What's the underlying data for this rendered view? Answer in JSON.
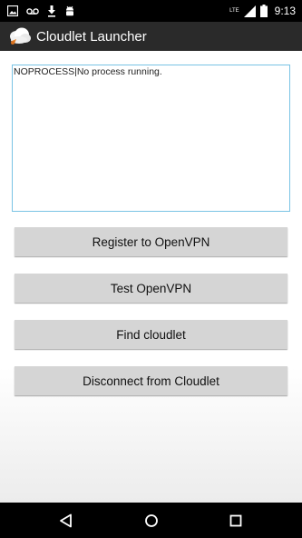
{
  "status_bar": {
    "icons_left": [
      "image-icon",
      "voicemail-icon",
      "download-icon",
      "android-icon"
    ],
    "icons_right": [
      "signal-lte-icon",
      "signal-bars-icon",
      "battery-icon"
    ],
    "signal_label": "LTE",
    "time": "9:13"
  },
  "action_bar": {
    "title": "Cloudlet Launcher",
    "background": "#2a2a2a"
  },
  "log": {
    "text": "NOPROCESS|No process running.",
    "border_color": "#79c3e4"
  },
  "buttons": {
    "register": "Register to OpenVPN",
    "test": "Test OpenVPN",
    "find": "Find cloudlet",
    "disconnect": "Disconnect from Cloudlet"
  },
  "nav_bar": {
    "icons": [
      "back-icon",
      "home-icon",
      "recents-icon"
    ]
  }
}
